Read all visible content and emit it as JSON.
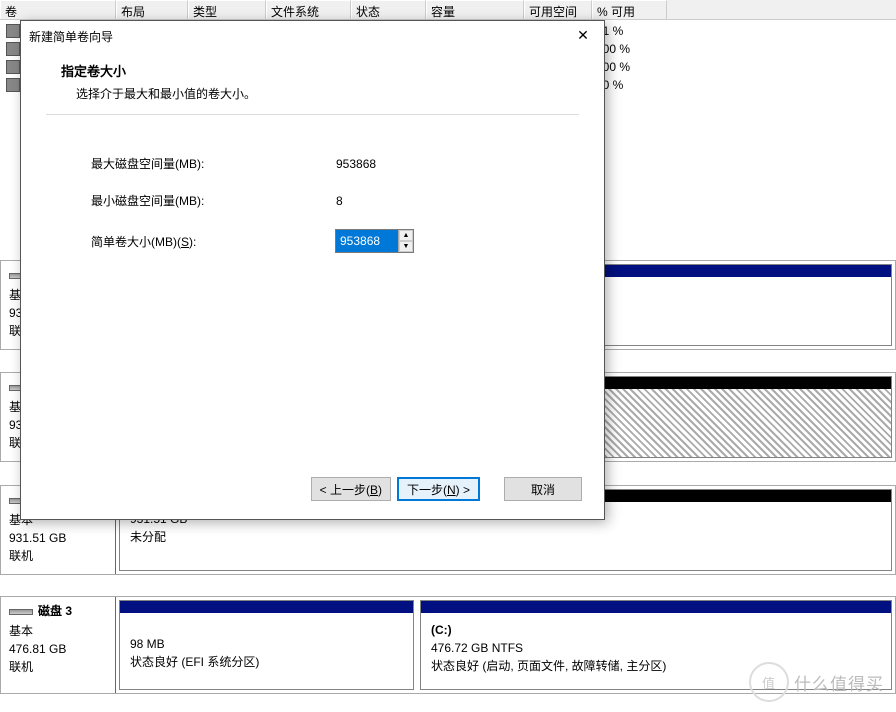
{
  "headers": [
    "卷",
    "布局",
    "类型",
    "文件系统",
    "状态",
    "容量",
    "可用空间",
    "% 可用"
  ],
  "rows_pct": [
    "71 %",
    "100 %",
    "100 %",
    "60 %"
  ],
  "dialog": {
    "title": "新建简单卷向导",
    "heading": "指定卷大小",
    "sub": "选择介于最大和最小值的卷大小。",
    "max_label": "最大磁盘空间量(MB):",
    "max_value": "953868",
    "min_label": "最小磁盘空间量(MB):",
    "min_value": "8",
    "size_label_pre": "简单卷大小(MB)(",
    "size_label_key": "S",
    "size_label_post": "):",
    "size_value": "953868",
    "back_pre": "< 上一步(",
    "back_key": "B",
    "back_post": ")",
    "next_pre": "下一步(",
    "next_key": "N",
    "next_post": ") >",
    "cancel": "取消"
  },
  "disk_mid": {
    "basic": "基",
    "size": "93",
    "status": "联"
  },
  "disk2_left": {
    "basic": "基本",
    "size": "931.51 GB",
    "status": "联机"
  },
  "disk2_part": {
    "size": "931.51 GB",
    "status": "未分配"
  },
  "disk3": {
    "title": "磁盘 3",
    "basic": "基本",
    "size": "476.81 GB",
    "status": "联机"
  },
  "disk3_p1": {
    "size": "98 MB",
    "status": "状态良好 (EFI 系统分区)"
  },
  "disk3_p2": {
    "title": "(C:)",
    "size": "476.72 GB NTFS",
    "status": "状态良好 (启动, 页面文件, 故障转储, 主分区)"
  },
  "watermark": "什么值得买",
  "watermark_inner": "值"
}
